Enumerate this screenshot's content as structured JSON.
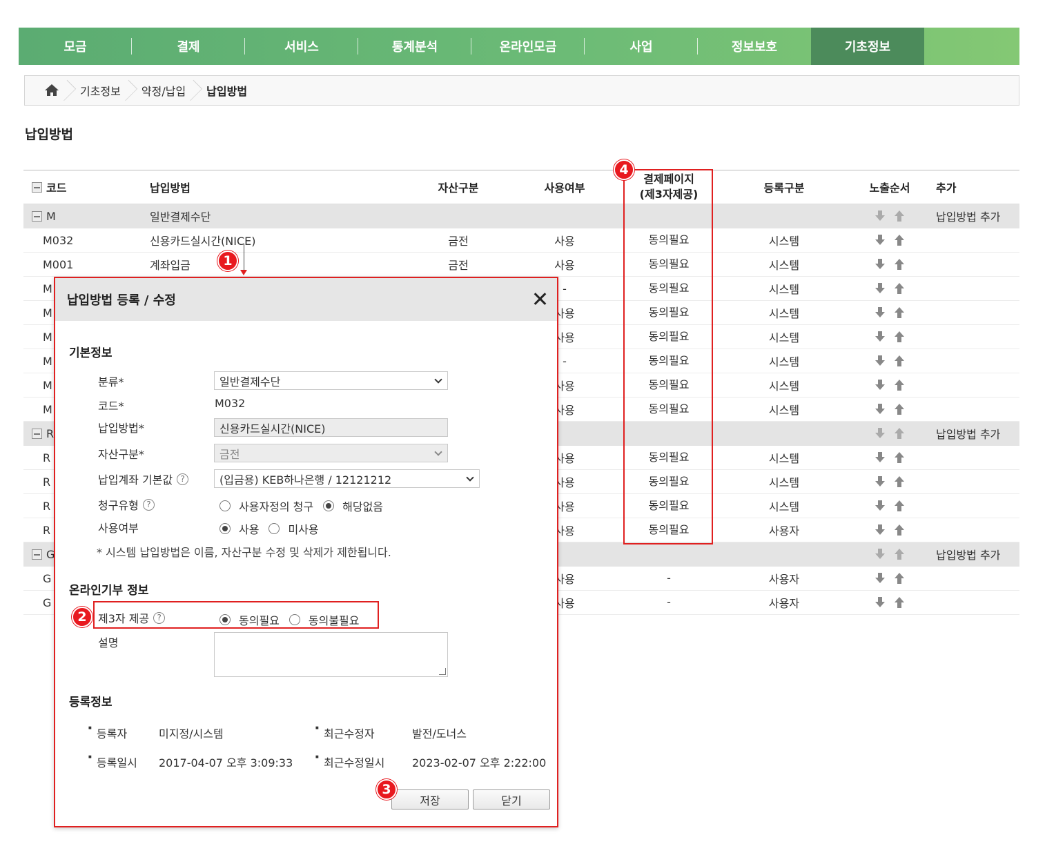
{
  "nav": {
    "items": [
      "모금",
      "결제",
      "서비스",
      "통계분석",
      "온라인모금",
      "사업",
      "정보보호",
      "기초정보"
    ],
    "active_index": 7
  },
  "breadcrumb": {
    "items": [
      "기초정보",
      "약정/납입",
      "납입방법"
    ]
  },
  "page_title": "납입방법",
  "table": {
    "headers": {
      "code": "코드",
      "method": "납입방법",
      "asset": "자산구분",
      "use": "사용여부",
      "pay_line1": "결제페이지",
      "pay_line2": "(제3자제공)",
      "reg": "등록구분",
      "order": "노출순서",
      "add": "추가"
    },
    "rows": [
      {
        "type": "group",
        "code": "M",
        "method": "일반결제수단",
        "add": "납입방법 추가"
      },
      {
        "type": "item",
        "code": "M032",
        "method": "신용카드실시간(NICE)",
        "asset": "금전",
        "use": "사용",
        "pay": "동의필요",
        "reg": "시스템"
      },
      {
        "type": "item",
        "code": "M001",
        "method": "계좌입금",
        "asset": "금전",
        "use": "사용",
        "pay": "동의필요",
        "reg": "시스템"
      },
      {
        "type": "item",
        "code": "M",
        "method": "",
        "asset": "",
        "use": "-",
        "pay": "동의필요",
        "reg": "시스템"
      },
      {
        "type": "item",
        "code": "M",
        "method": "",
        "asset": "",
        "use": "사용",
        "pay": "동의필요",
        "reg": "시스템"
      },
      {
        "type": "item",
        "code": "M",
        "method": "",
        "asset": "",
        "use": "사용",
        "pay": "동의필요",
        "reg": "시스템"
      },
      {
        "type": "item",
        "code": "M",
        "method": "",
        "asset": "",
        "use": "-",
        "pay": "동의필요",
        "reg": "시스템"
      },
      {
        "type": "item",
        "code": "M",
        "method": "",
        "asset": "",
        "use": "사용",
        "pay": "동의필요",
        "reg": "시스템"
      },
      {
        "type": "item",
        "code": "M",
        "method": "",
        "asset": "",
        "use": "사용",
        "pay": "동의필요",
        "reg": "시스템"
      },
      {
        "type": "group",
        "code": "R",
        "method": "",
        "add": "납입방법 추가"
      },
      {
        "type": "item",
        "code": "R",
        "method": "",
        "asset": "",
        "use": "사용",
        "pay": "동의필요",
        "reg": "시스템"
      },
      {
        "type": "item",
        "code": "R",
        "method": "",
        "asset": "",
        "use": "사용",
        "pay": "동의필요",
        "reg": "시스템"
      },
      {
        "type": "item",
        "code": "R",
        "method": "",
        "asset": "",
        "use": "사용",
        "pay": "동의필요",
        "reg": "시스템"
      },
      {
        "type": "item",
        "code": "R",
        "method": "",
        "asset": "",
        "use": "사용",
        "pay": "동의필요",
        "reg": "사용자"
      },
      {
        "type": "group",
        "code": "G",
        "method": "",
        "add": "납입방법 추가"
      },
      {
        "type": "item",
        "code": "G",
        "method": "",
        "asset": "",
        "use": "사용",
        "pay": "-",
        "reg": "사용자"
      },
      {
        "type": "item",
        "code": "G",
        "method": "",
        "asset": "",
        "use": "사용",
        "pay": "-",
        "reg": "사용자"
      }
    ]
  },
  "modal": {
    "title": "납입방법 등록 / 수정",
    "section_basic": "기본정보",
    "labels": {
      "category": "분류*",
      "code": "코드*",
      "method": "납입방법*",
      "asset": "자산구분*",
      "account": "납입계좌 기본값",
      "billing": "청구유형",
      "use": "사용여부"
    },
    "values": {
      "category": "일반결제수단",
      "code": "M032",
      "method": "신용카드실시간(NICE)",
      "asset": "금전",
      "account": "(입금용) KEB하나은행 / 12121212"
    },
    "billing_options": [
      "사용자정의 청구",
      "해당없음"
    ],
    "billing_selected": 1,
    "use_options": [
      "사용",
      "미사용"
    ],
    "use_selected": 0,
    "note": "* 시스템 납입방법은 이름, 자산구분 수정 및 삭제가 제한됩니다.",
    "section_online": "온라인기부 정보",
    "third_party_label": "제3자 제공",
    "third_party_options": [
      "동의필요",
      "동의불필요"
    ],
    "third_party_selected": 0,
    "desc_label": "설명",
    "section_reg": "등록정보",
    "reg": {
      "registrant_label": "등록자",
      "registrant": "미지정/시스템",
      "modifier_label": "최근수정자",
      "modifier": "발전/도너스",
      "reg_date_label": "등록일시",
      "reg_date": "2017-04-07 오후 3:09:33",
      "mod_date_label": "최근수정일시",
      "mod_date": "2023-02-07 오후 2:22:00"
    },
    "save_label": "저장",
    "close_label": "닫기"
  },
  "badges": [
    "1",
    "2",
    "3",
    "4"
  ],
  "help_glyph": "?",
  "accent_color": "#e02020"
}
